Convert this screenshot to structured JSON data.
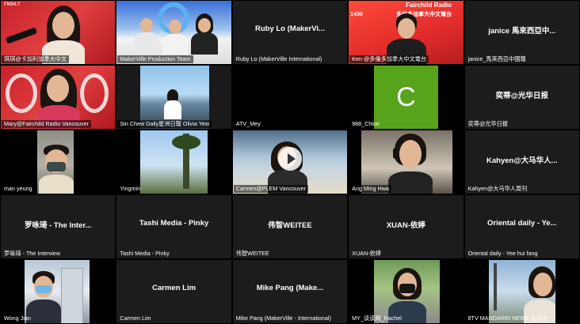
{
  "meeting": {
    "tiles": [
      {
        "label": "琪琪@卡加利加拿大中文",
        "center_name": ""
      },
      {
        "label": "MakerVille Production Team",
        "center_name": ""
      },
      {
        "label": "Ruby Lo (MakerVille International)",
        "center_name": "Ruby Lo (MakerVi..."
      },
      {
        "label": "Ken @多倫多加拿大中文電台",
        "center_name": "",
        "sign_top": "Fairchild Radio",
        "sign_num": "1430",
        "sign_cn": "多倫多加拿大中文電台"
      },
      {
        "label": "janice_馬來西亞中國報",
        "center_name": "janice 馬來西亞中..."
      },
      {
        "label": "Mary@Fairchild Radio Vancouver",
        "center_name": ""
      },
      {
        "label": "Sin Chew Daily星洲日報 Olivia Yew",
        "center_name": ""
      },
      {
        "label": "ATV_Mey",
        "center_name": ""
      },
      {
        "label": "988_Chloe",
        "center_name": "",
        "avatar_letter": "C"
      },
      {
        "label": "奕蒂@光华日报",
        "center_name": "奕蒂@光华日报"
      },
      {
        "label": "man yeung",
        "center_name": ""
      },
      {
        "label": "Yingmin",
        "center_name": ""
      },
      {
        "label": "Carmen@PLEM Vancouver",
        "center_name": ""
      },
      {
        "label": "Ang Ming Hwa",
        "center_name": ""
      },
      {
        "label": "Kahyen@大马华人周刊",
        "center_name": "Kahyen@大马华人..."
      },
      {
        "label": "罗咏琦 - The Interview",
        "center_name": "罗咏琦 - The Inter..."
      },
      {
        "label": "Tashi Media - Pinky",
        "center_name": "Tashi Media - Pinky"
      },
      {
        "label": "伟智WEITEE",
        "center_name": "伟智WEITEE"
      },
      {
        "label": "XUAN-依婷",
        "center_name": "XUAN-依婷"
      },
      {
        "label": "Oriental daily - Yee hui fang",
        "center_name": "Oriental daily - Ye..."
      },
      {
        "label": "Wong Jian",
        "center_name": ""
      },
      {
        "label": "Carmen Lim",
        "center_name": "Carmen Lim"
      },
      {
        "label": "Mike Pang (MakerVille - International)",
        "center_name": "Mike Pang (Make..."
      },
      {
        "label": "MY_谈谈网_Rachel",
        "center_name": ""
      },
      {
        "label": "8TV MANDARIN NEWS 张琼亦",
        "center_name": ""
      }
    ]
  }
}
